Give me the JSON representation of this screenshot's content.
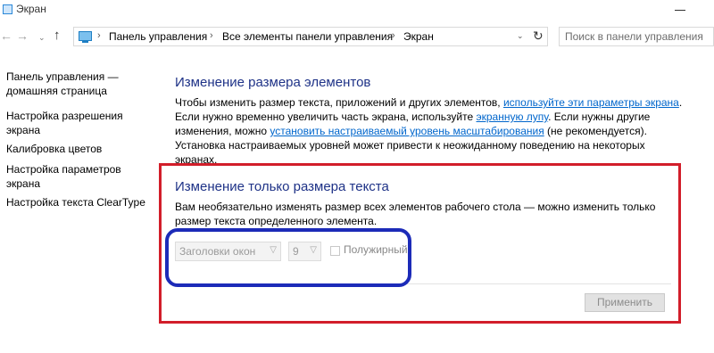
{
  "window": {
    "title": "Экран"
  },
  "toolbar": {
    "back_icon": "←",
    "forward_icon": "→",
    "recent_icon": "⌄",
    "up_icon": "↑",
    "refresh_icon": "↻",
    "dropdown_icon": "⌄"
  },
  "breadcrumb": {
    "items": [
      "Панель управления",
      "Все элементы панели управления",
      "Экран"
    ],
    "separator": "›"
  },
  "search": {
    "placeholder": "Поиск в панели управления"
  },
  "sidebar": {
    "items": [
      {
        "label": "Панель управления — домашняя страница"
      },
      {
        "label": "Настройка разрешения экрана"
      },
      {
        "label": "Калибровка цветов"
      },
      {
        "label": "Настройка параметров экрана"
      },
      {
        "label": "Настройка текста ClearType"
      }
    ]
  },
  "main": {
    "heading1": "Изменение размера элементов",
    "para1": {
      "t1": "Чтобы изменить размер текста, приложений и других элементов, ",
      "link1": "используйте эти параметры экрана",
      "t2": ". Если нужно временно увеличить часть экрана, используйте ",
      "link2": "экранную лупу",
      "t3": ". Если нужны другие изменения, можно ",
      "link3": "установить настраиваемый уровень масштабирования",
      "t4": " (не рекомендуется). Установка настраиваемых уровней может привести к неожиданному поведению на некоторых экранах."
    },
    "heading2": "Изменение только размера текста",
    "para2": "Вам необязательно изменять размер всех элементов рабочего стола — можно изменить только размер текста определенного элемента.",
    "element_select": {
      "value": "Заголовки окон"
    },
    "size_select": {
      "value": "9"
    },
    "bold_checkbox": {
      "label": "Полужирный",
      "checked": false
    },
    "apply_button": "Применить"
  },
  "colors": {
    "heading": "#1e3287",
    "link": "#0066cc",
    "annotation_red": "#d21e2a",
    "annotation_blue": "#1c2bb8"
  }
}
